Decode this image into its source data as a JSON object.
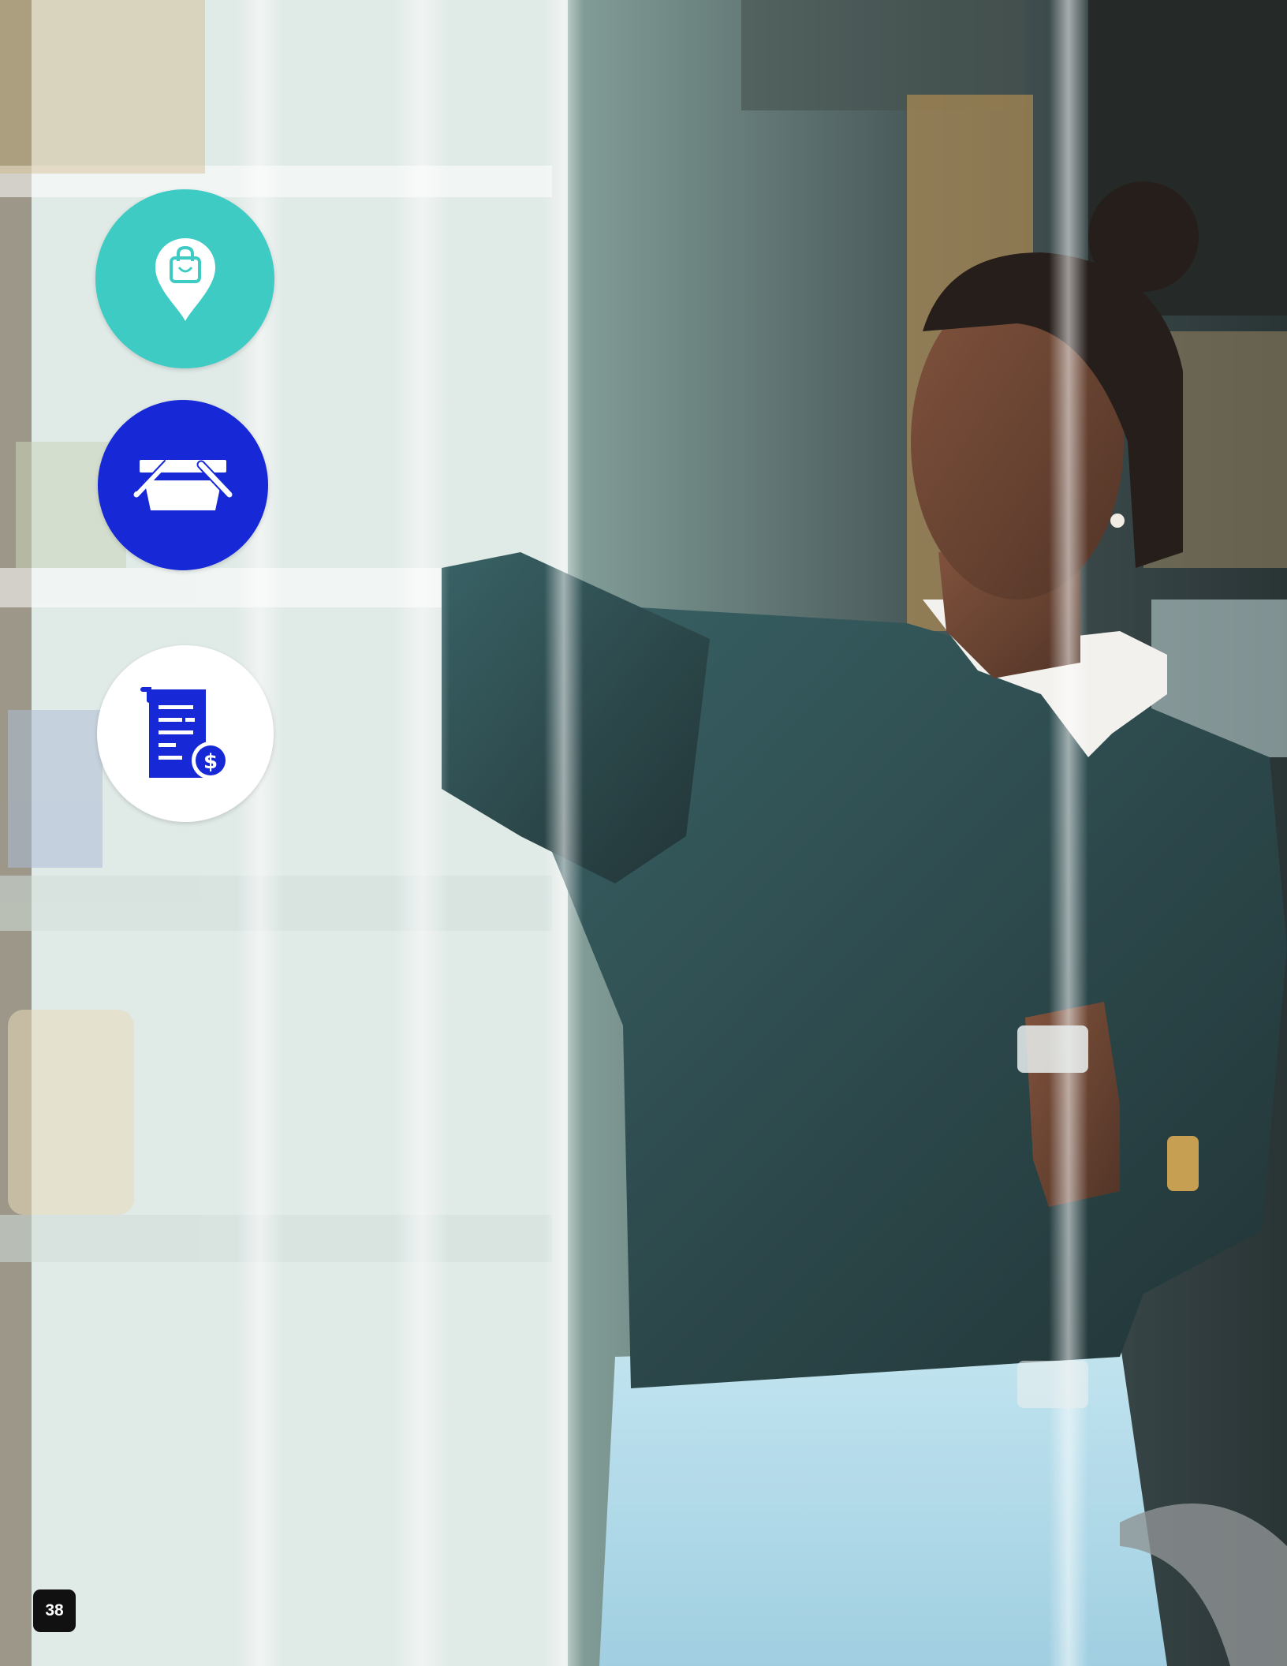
{
  "page": {
    "number": "38"
  },
  "photo": {
    "description_icon": "photo-icon"
  },
  "icons": [
    {
      "name": "shopping-bag-location-pin-icon",
      "color": "#3ecbc4"
    },
    {
      "name": "shopping-basket-icon",
      "color": "#1729d6"
    },
    {
      "name": "receipt-dollar-icon",
      "color": "#ffffff",
      "glyph_color": "#1729d6"
    }
  ]
}
